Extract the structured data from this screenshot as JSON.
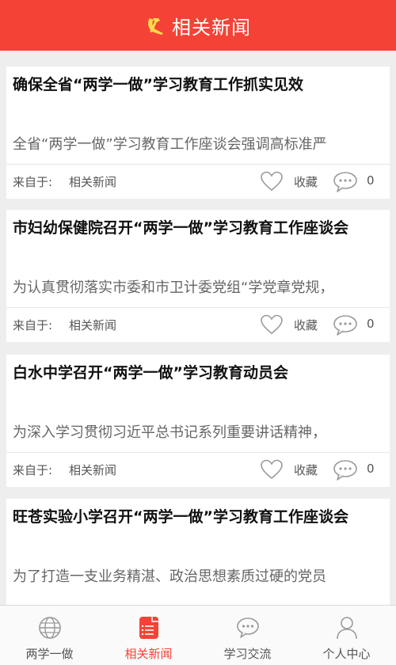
{
  "header": {
    "title": "相关新闻",
    "emblem_icon": "party-emblem-icon",
    "bg": "#f44336"
  },
  "articles": [
    {
      "title": "确保全省“两学一做”学习教育工作抓实见效",
      "summary": "全省“两学一做”学习教育工作座谈会强调高标准严",
      "source_label": "来自于:",
      "source_name": "相关新闻",
      "favorite_label": "收藏",
      "comment_count": "0"
    },
    {
      "title": "市妇幼保健院召开“两学一做”学习教育工作座谈会",
      "summary": "为认真贯彻落实市委和市卫计委党组“学党章党规，",
      "source_label": "来自于:",
      "source_name": "相关新闻",
      "favorite_label": "收藏",
      "comment_count": "0"
    },
    {
      "title": "白水中学召开“两学一做”学习教育动员会",
      "summary": "为深入学习贯彻习近平总书记系列重要讲话精神，",
      "source_label": "来自于:",
      "source_name": "相关新闻",
      "favorite_label": "收藏",
      "comment_count": "0"
    },
    {
      "title": "旺苍实验小学召开“两学一做”学习教育工作座谈会",
      "summary": "为了打造一支业务精湛、政治思想素质过硬的党员",
      "source_label": "来自于:",
      "source_name": "相关新闻",
      "favorite_label": "收藏",
      "comment_count": "0"
    }
  ],
  "tabbar": {
    "active_color": "#f44336",
    "tabs": [
      {
        "label": "两学一做",
        "icon": "globe-icon",
        "active": false
      },
      {
        "label": "相关新闻",
        "icon": "news-document-icon",
        "active": true
      },
      {
        "label": "学习交流",
        "icon": "chat-bubble-icon",
        "active": false
      },
      {
        "label": "个人中心",
        "icon": "person-icon",
        "active": false
      }
    ]
  }
}
